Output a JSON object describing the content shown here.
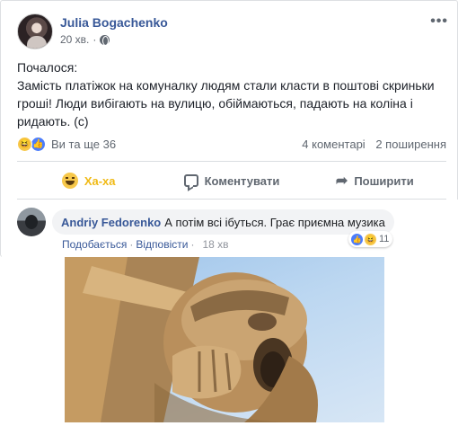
{
  "post": {
    "author": "Julia Bogachenko",
    "time": "20 хв.",
    "more_label": "•••",
    "text_lines": [
      "Почалося:",
      "Замість платіжок на комуналку людям стали класти в поштові скриньки",
      "гроші! Люди вибігають на вулицю, обіймаються, падають на коліна і",
      "ридають. (c)"
    ]
  },
  "summary": {
    "others": "Ви та ще 36",
    "comments": "4 коментарі",
    "shares": "2 поширення"
  },
  "actions": {
    "reaction_label": "Ха-ха",
    "comment_label": "Коментувати",
    "share_label": "Поширити"
  },
  "comment": {
    "author": "Andriy Fedorenko",
    "text": "А потім всі ібуться. Грає приємна музика",
    "like_label": "Подобається",
    "reply_label": "Відповісти",
    "time": "18 хв",
    "reaction_count": "11"
  },
  "colors": {
    "link_blue": "#385898",
    "haha_yellow": "#f0ba15",
    "like_blue": "#4c7dfb",
    "sky": "#a8cbee",
    "stone": "#c9a878"
  },
  "icons": [
    "globe-icon",
    "more-icon",
    "haha-icon",
    "like-icon",
    "comment-icon",
    "share-icon"
  ]
}
